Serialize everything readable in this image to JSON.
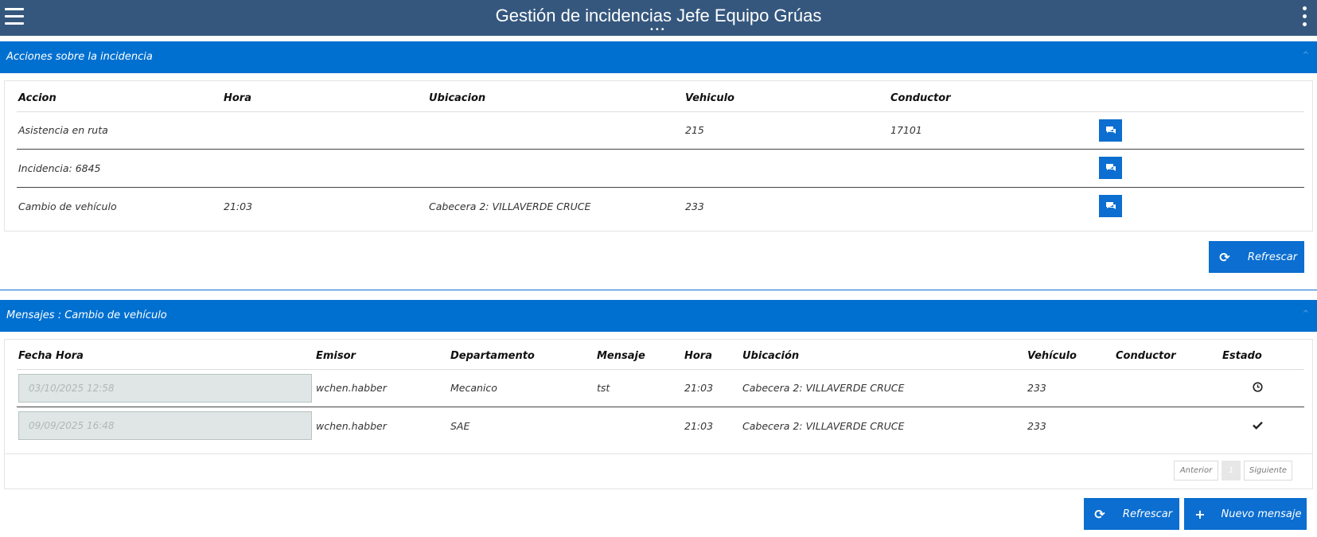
{
  "header": {
    "title": "Gestión de incidencias Jefe Equipo Grúas"
  },
  "acciones": {
    "title": "Acciones sobre la incidencia",
    "columns": [
      "Accion",
      "Hora",
      "Ubicacion",
      "Vehiculo",
      "Conductor"
    ],
    "rows": [
      {
        "accion": "Asistencia en ruta",
        "hora": "",
        "ubicacion": "",
        "vehiculo": "215",
        "conductor": "17101"
      },
      {
        "accion": "Incidencia: 6845",
        "hora": "",
        "ubicacion": "",
        "vehiculo": "",
        "conductor": ""
      },
      {
        "accion": "Cambio de vehículo",
        "hora": "21:03",
        "ubicacion": "Cabecera 2: VILLAVERDE CRUCE",
        "vehiculo": "233",
        "conductor": ""
      }
    ],
    "refresh_label": "Refrescar"
  },
  "mensajes": {
    "title": "Mensajes : Cambio de vehículo",
    "columns": [
      "Fecha Hora",
      "Emisor",
      "Departamento",
      "Mensaje",
      "Hora",
      "Ubicación",
      "Vehículo",
      "Conductor",
      "Estado"
    ],
    "rows": [
      {
        "fecha": "03/10/2025 12:58",
        "emisor": "wchen.habber",
        "departamento": "Mecanico",
        "mensaje": "tst",
        "hora": "21:03",
        "ubicacion": "Cabecera 2: VILLAVERDE CRUCE",
        "vehiculo": "233",
        "conductor": "",
        "estado_icon": "clock-icon"
      },
      {
        "fecha": "09/09/2025 16:48",
        "emisor": "wchen.habber",
        "departamento": "SAE",
        "mensaje": "",
        "hora": "21:03",
        "ubicacion": "Cabecera 2: VILLAVERDE CRUCE",
        "vehiculo": "233",
        "conductor": "",
        "estado_icon": "check-icon"
      }
    ],
    "pager": {
      "prev": "Anterior",
      "page": "1",
      "next": "Siguiente"
    },
    "refresh_label": "Refrescar",
    "new_label": "Nuevo mensaje"
  }
}
